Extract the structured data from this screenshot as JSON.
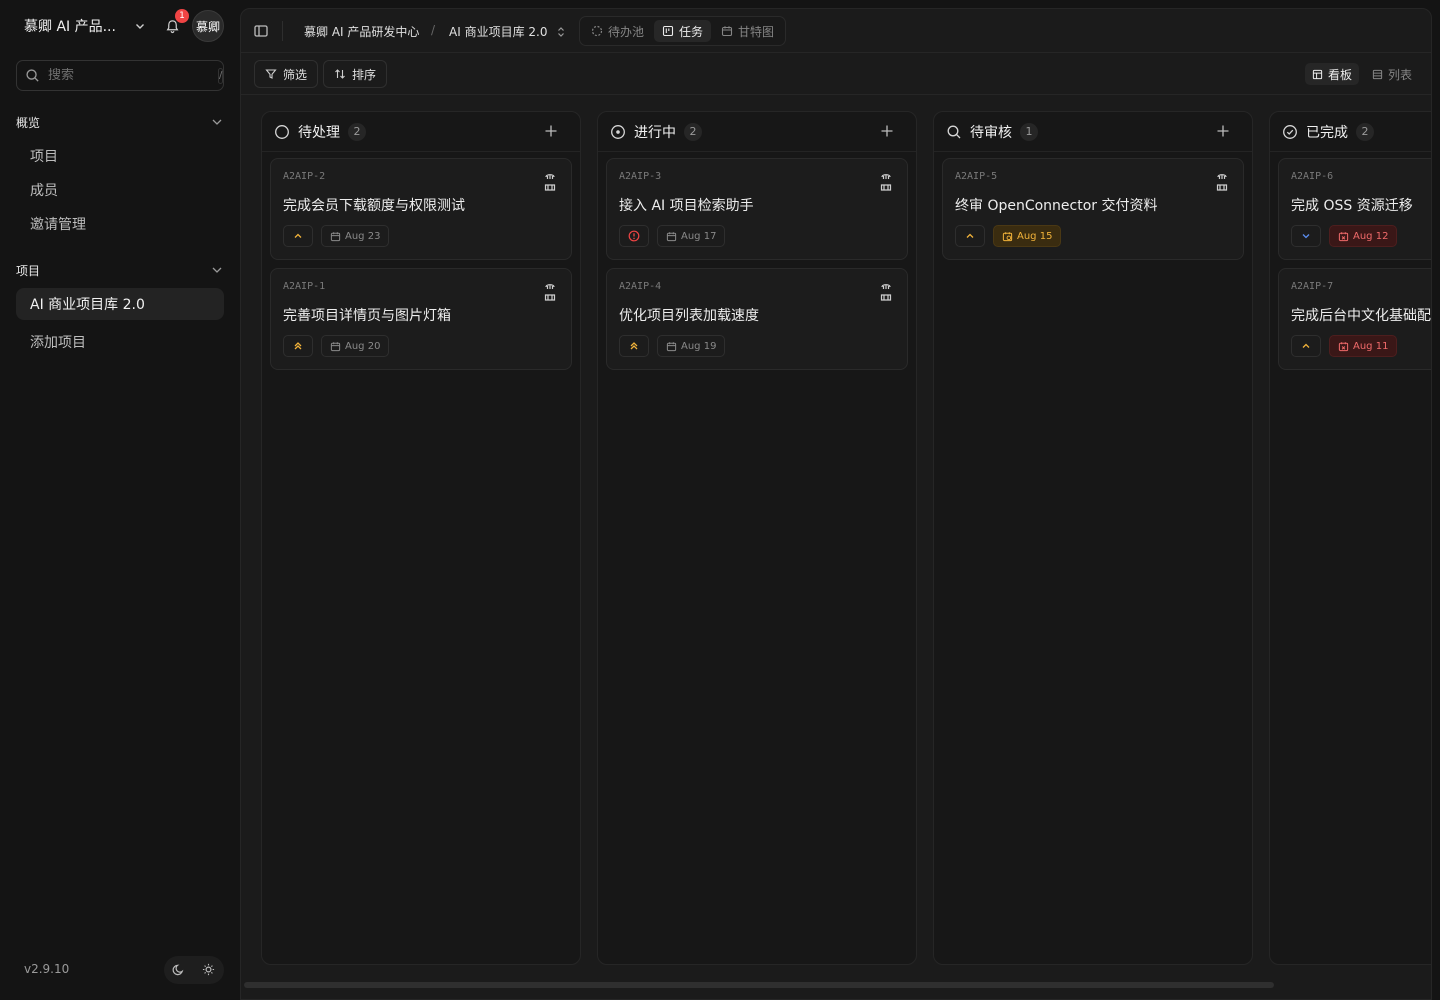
{
  "workspace": {
    "name": "慕卿 AI 产品...",
    "notifications": "1",
    "avatar": "慕卿"
  },
  "search": {
    "placeholder": "搜索",
    "shortcut": "/"
  },
  "sidebar": {
    "overview": {
      "title": "概览",
      "items": [
        "项目",
        "成员",
        "邀请管理"
      ]
    },
    "projects": {
      "title": "项目",
      "items": [
        "AI 商业项目库 2.0"
      ],
      "add": "添加项目"
    }
  },
  "footer": {
    "version": "v2.9.10"
  },
  "breadcrumb": {
    "org": "慕卿 AI 产品研发中心",
    "separator": "/",
    "project": "AI 商业项目库 2.0"
  },
  "views": {
    "backlog": "待办池",
    "tasks": "任务",
    "gantt": "甘特图"
  },
  "toolbar": {
    "filter": "筛选",
    "sort": "排序",
    "board": "看板",
    "list": "列表"
  },
  "columns": [
    {
      "title": "待处理",
      "count": "2",
      "cards": [
        {
          "key": "A2AIP-2",
          "title": "完成会员下载额度与权限测试",
          "priority": "medium",
          "due": "Aug 23",
          "due_state": "normal"
        },
        {
          "key": "A2AIP-1",
          "title": "完善项目详情页与图片灯箱",
          "priority": "high",
          "due": "Aug 20",
          "due_state": "normal"
        }
      ]
    },
    {
      "title": "进行中",
      "count": "2",
      "cards": [
        {
          "key": "A2AIP-3",
          "title": "接入 AI 项目检索助手",
          "priority": "urgent",
          "due": "Aug 17",
          "due_state": "normal"
        },
        {
          "key": "A2AIP-4",
          "title": "优化项目列表加载速度",
          "priority": "high",
          "due": "Aug 19",
          "due_state": "normal"
        }
      ]
    },
    {
      "title": "待审核",
      "count": "1",
      "cards": [
        {
          "key": "A2AIP-5",
          "title": "终审 OpenConnector 交付资料",
          "priority": "medium",
          "due": "Aug 15",
          "due_state": "soon"
        }
      ]
    },
    {
      "title": "已完成",
      "count": "2",
      "cards": [
        {
          "key": "A2AIP-6",
          "title": "完成 OSS 资源迁移",
          "priority": "low",
          "due": "Aug 12",
          "due_state": "overdue"
        },
        {
          "key": "A2AIP-7",
          "title": "完成后台中文化基础配置",
          "priority": "medium",
          "due": "Aug 11",
          "due_state": "overdue"
        }
      ]
    }
  ],
  "colors": {
    "urgent": "#ef4444",
    "high": "#f2b33a",
    "medium": "#f2b33a",
    "low": "#5b8def",
    "soon": "#f2b33a",
    "overdue": "#f06a6a"
  }
}
